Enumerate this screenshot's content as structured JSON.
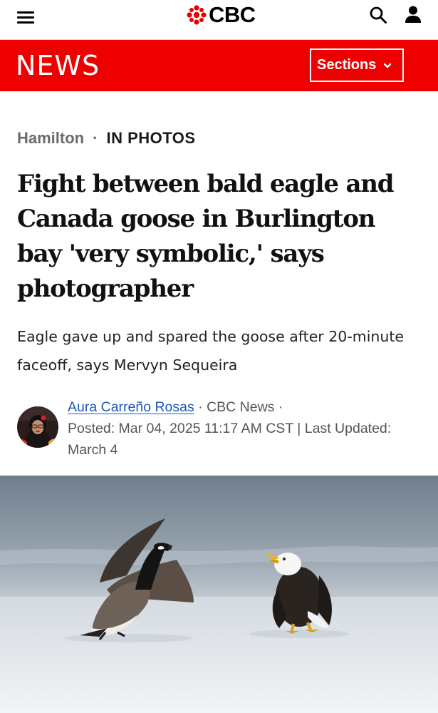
{
  "header": {
    "menu_icon": "hamburger-menu-icon",
    "brand": "CBC",
    "search_icon": "search-icon",
    "account_icon": "user-icon"
  },
  "newsbar": {
    "title": "NEWS",
    "sections_label": "Sections",
    "background_color": "#ee0000"
  },
  "article": {
    "region": "Hamilton",
    "separator": "·",
    "section": "IN PHOTOS",
    "headline": "Fight between bald eagle and Canada goose in Burlington bay 'very symbolic,' says photographer",
    "deck": "Eagle gave up and spared the goose after 20-minute faceoff, says Mervyn Sequeira",
    "byline": {
      "author": "Aura Carreño Rosas",
      "outlet": "· CBC News ·",
      "posted": "Posted: Mar 04, 2025 11:17 AM CST | Last Updated: March 4"
    },
    "photo_description_icon": "eagle-and-goose-photo"
  },
  "colors": {
    "link": "#1c5ab6",
    "brand_red": "#ee0000"
  }
}
